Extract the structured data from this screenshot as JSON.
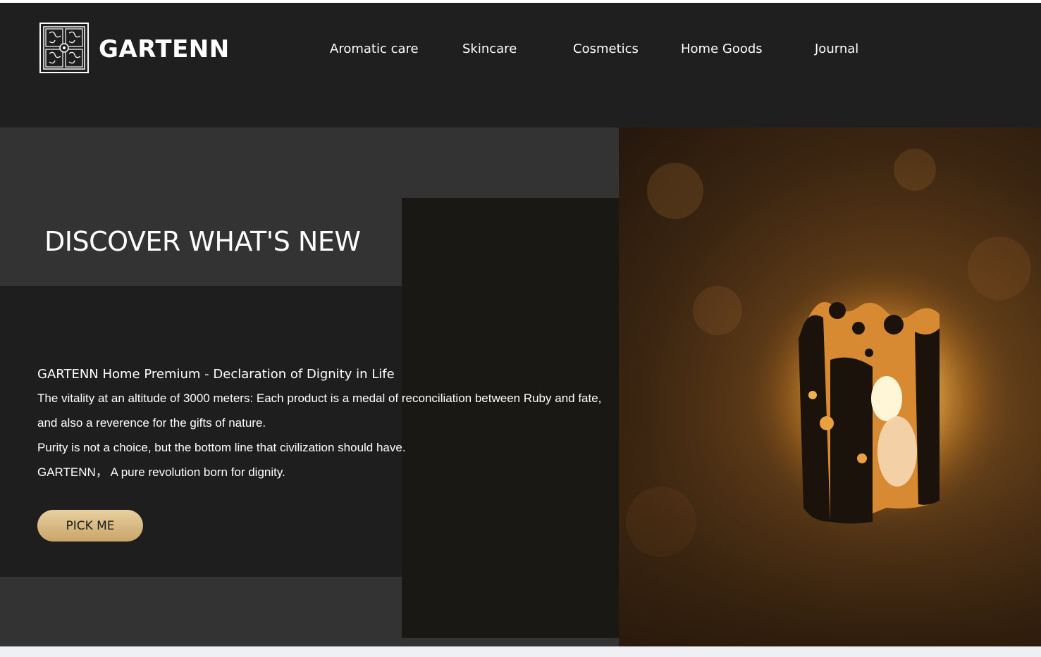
{
  "brand": {
    "name": "GARTENN",
    "logo_icon": "ornamental-square-logo-icon"
  },
  "nav": {
    "items": [
      {
        "label": "Aromatic care"
      },
      {
        "label": "Skincare"
      },
      {
        "label": "Cosmetics"
      },
      {
        "label": "Home Goods"
      },
      {
        "label": "Journal"
      }
    ]
  },
  "hero": {
    "headline": "DISCOVER WHAT'S NEW",
    "subtitle": "GARTENN Home Premium - Declaration of Dignity in Life",
    "body_lines": [
      "The vitality at an altitude of 3000 meters: Each product is a medal of reconciliation between Ruby and fate,",
      "and also a reverence for the gifts of nature.",
      "Purity is not a choice, but the bottom line that civilization should have.",
      "GARTENN，  A pure revolution born for dignity."
    ],
    "cta_label": "PICK ME",
    "image_subject": "candle-lantern-photo"
  },
  "colors": {
    "header_bg": "#1f1f20",
    "panel_bg": "#333334",
    "band_bg": "#1e1e1f",
    "accent_gold": "#d9bb85",
    "text": "#ffffff"
  }
}
